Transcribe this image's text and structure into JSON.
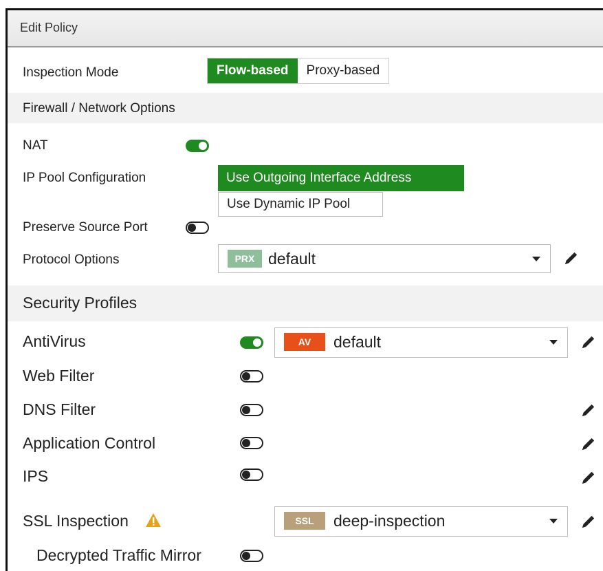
{
  "dialog": {
    "title": "Edit Policy"
  },
  "inspection_mode": {
    "label": "Inspection Mode",
    "options": [
      "Flow-based",
      "Proxy-based"
    ],
    "selected": "Flow-based"
  },
  "firewall_section": {
    "title": "Firewall / Network Options",
    "nat": {
      "label": "NAT",
      "enabled": true
    },
    "ip_pool": {
      "label": "IP Pool Configuration",
      "options": [
        "Use Outgoing Interface Address",
        "Use Dynamic IP Pool"
      ],
      "selected": "Use Outgoing Interface Address"
    },
    "preserve_source_port": {
      "label": "Preserve Source Port",
      "enabled": false
    },
    "protocol_options": {
      "label": "Protocol Options",
      "badge": "PRX",
      "value": "default"
    }
  },
  "security_section": {
    "title": "Security Profiles",
    "antivirus": {
      "label": "AntiVirus",
      "enabled": true,
      "badge": "AV",
      "value": "default"
    },
    "web_filter": {
      "label": "Web Filter",
      "enabled": false
    },
    "dns_filter": {
      "label": "DNS Filter",
      "enabled": false
    },
    "application_control": {
      "label": "Application Control",
      "enabled": false
    },
    "ips": {
      "label": "IPS",
      "enabled": false
    },
    "ssl_inspection": {
      "label": "SSL Inspection",
      "badge": "SSL",
      "value": "deep-inspection",
      "warning_icon": "warning-icon"
    },
    "decrypted_traffic_mirror": {
      "label": "Decrypted Traffic Mirror",
      "enabled": false
    }
  },
  "colors": {
    "accent_green": "#1f8a1f",
    "prx_badge": "#8fbf9a",
    "av_badge": "#e8501a",
    "ssl_badge": "#b9a07a",
    "warning": "#e8a21a"
  }
}
